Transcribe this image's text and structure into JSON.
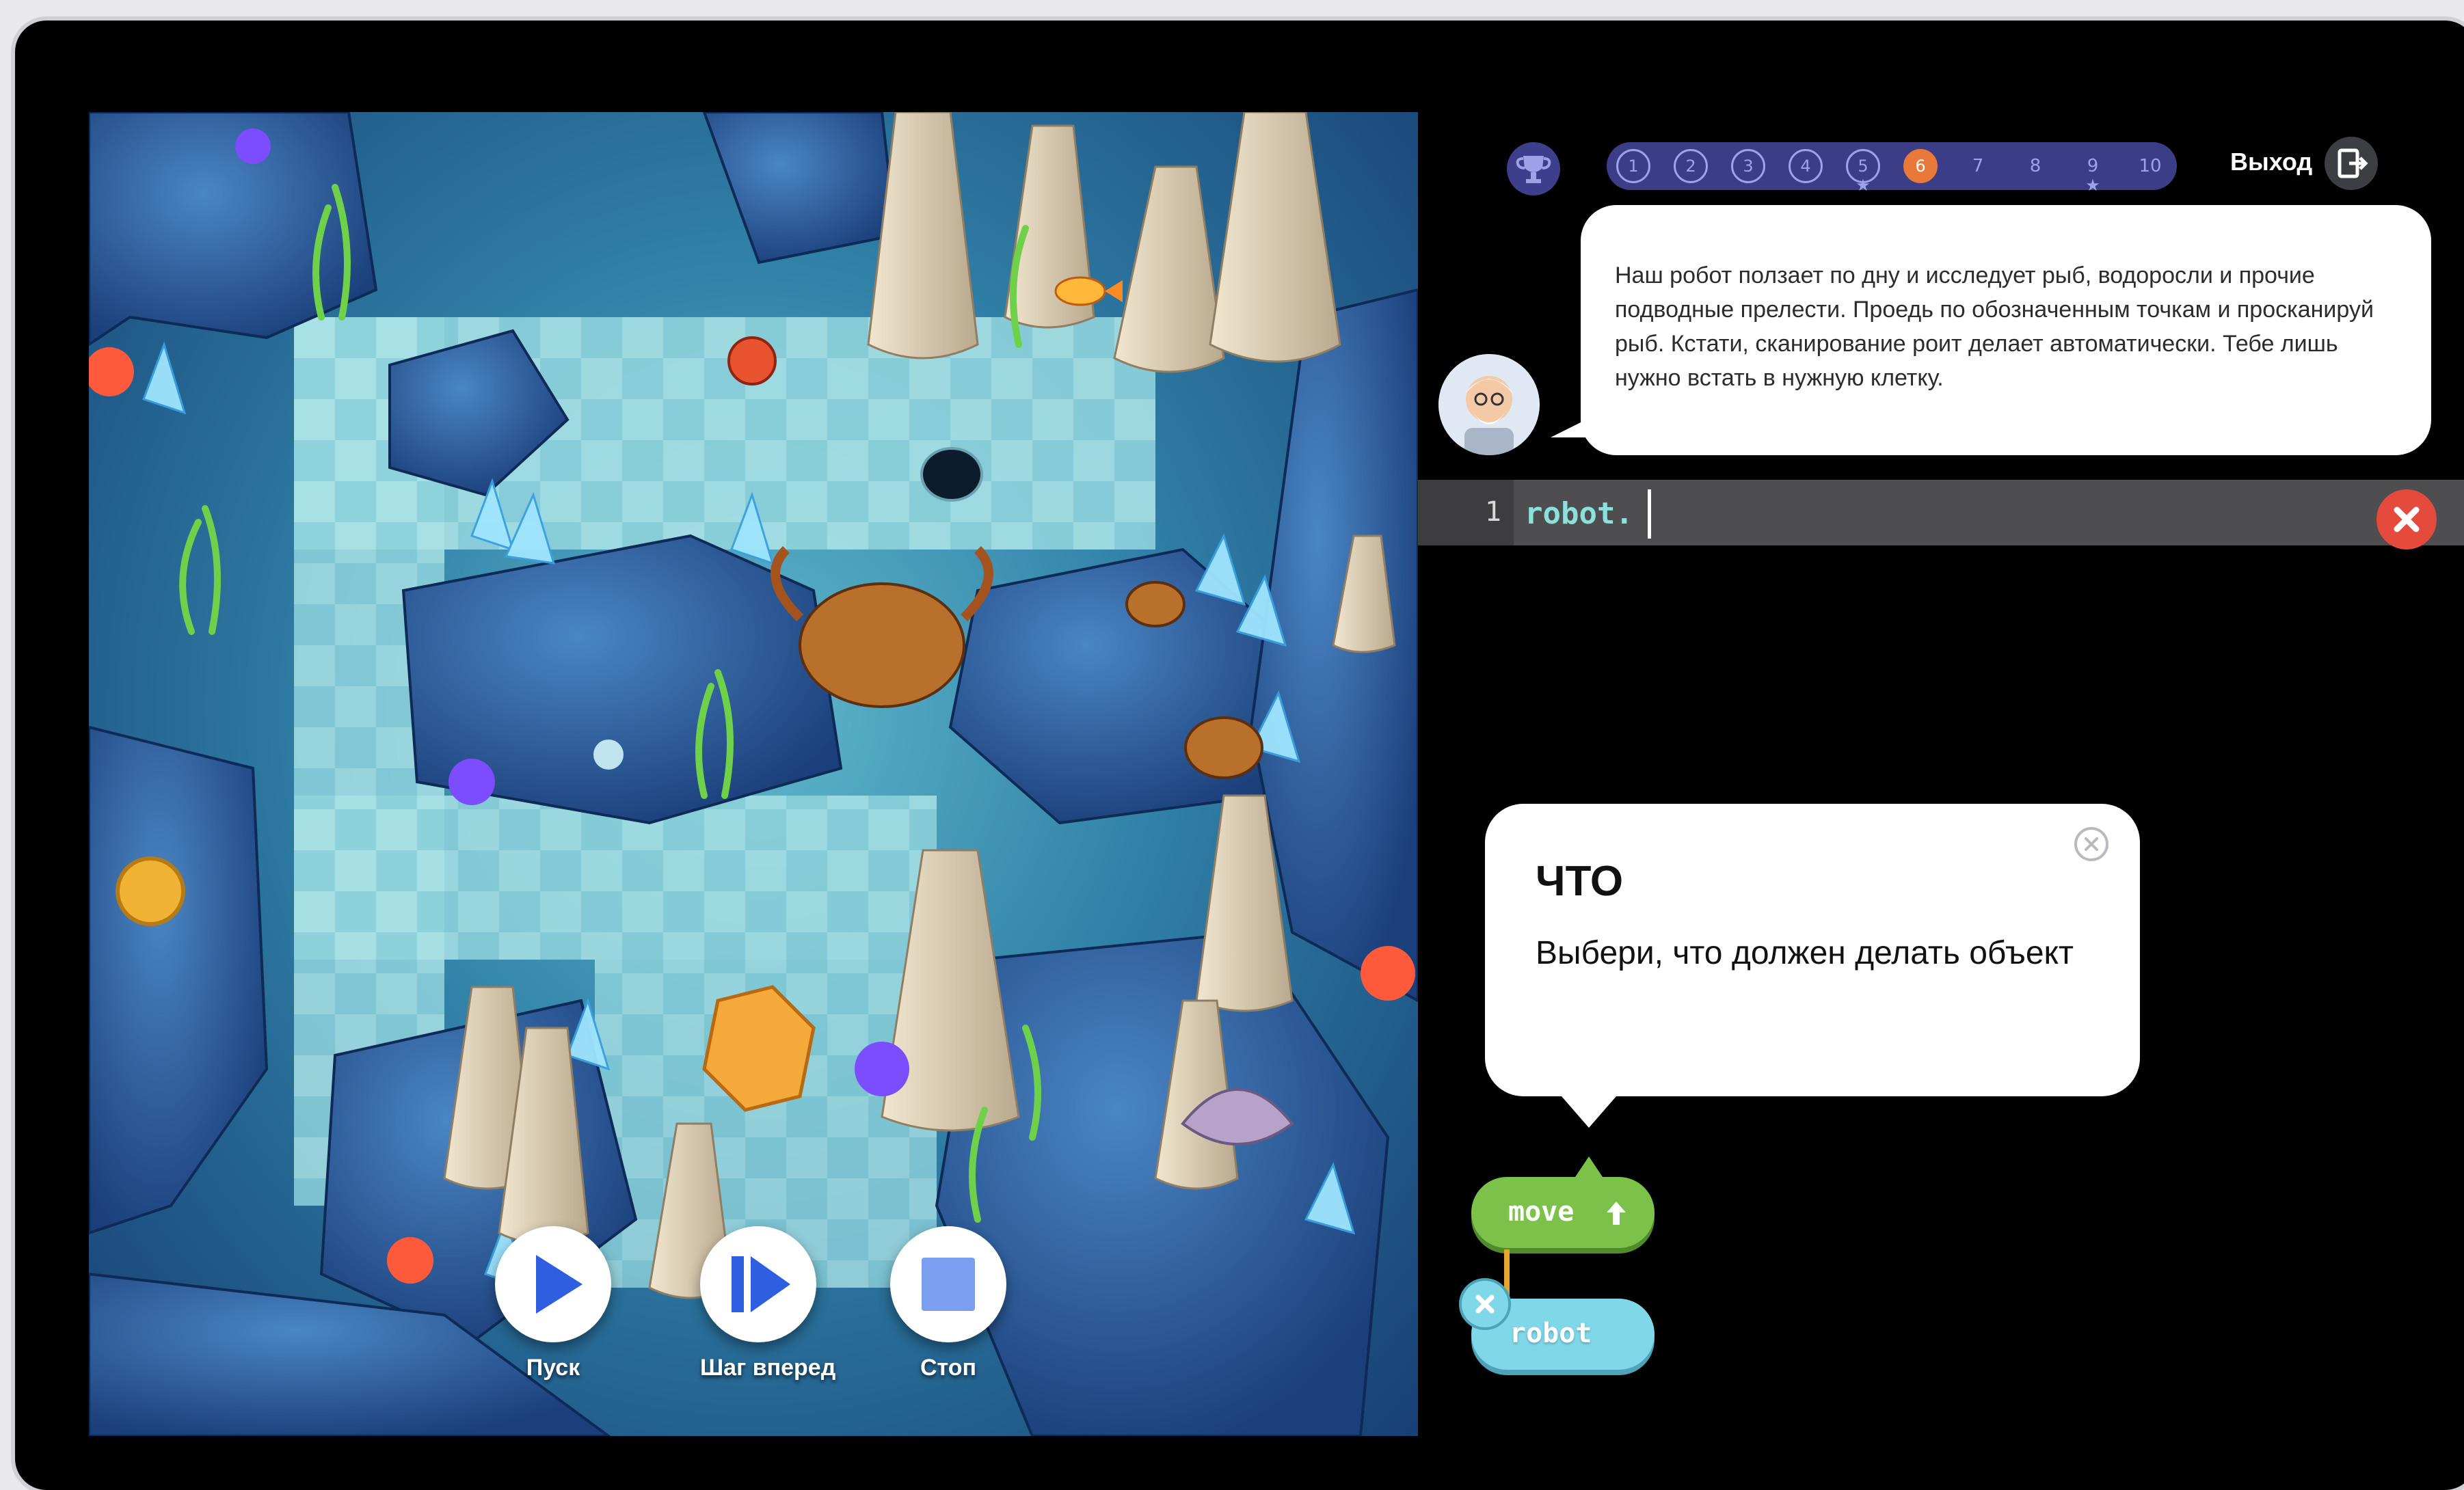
{
  "header": {
    "levels": [
      {
        "label": "1",
        "completed": true,
        "star": false
      },
      {
        "label": "2",
        "completed": true,
        "star": false
      },
      {
        "label": "3",
        "completed": true,
        "star": false
      },
      {
        "label": "4",
        "completed": true,
        "star": false
      },
      {
        "label": "5",
        "completed": true,
        "star": true
      },
      {
        "label": "6",
        "current": true,
        "star": false
      },
      {
        "label": "7",
        "star": false
      },
      {
        "label": "8",
        "star": false
      },
      {
        "label": "9",
        "star": true
      },
      {
        "label": "10",
        "star": false
      }
    ],
    "exit_label": "Выход",
    "trophy_icon": "trophy-icon",
    "exit_icon": "exit-door-icon"
  },
  "mission": {
    "text": "Наш робот ползает по дну и исследует рыб, водоросли и прочие подводные прелести.  Проедь по обозначенным точкам и просканируй рыб. Кстати, сканирование роит делает автоматически. Тебе лишь нужно встать в нужную клетку."
  },
  "editor": {
    "line_number": "1",
    "code": "robot."
  },
  "tooltip": {
    "title": "ЧТО",
    "text": "Выбери, что должен делать объект"
  },
  "blocks": {
    "move_label": "move",
    "robot_label": "robot"
  },
  "controls": {
    "run_label": "Пуск",
    "step_label": "Шаг вперед",
    "stop_label": "Стоп"
  },
  "colors": {
    "accent_current_level": "#e8793a",
    "level_bar": "#3b3d86",
    "move_block": "#7cc24a",
    "robot_block": "#80d7e8",
    "clear_button": "#e54b3c",
    "control_blue": "#2f5fe0"
  }
}
